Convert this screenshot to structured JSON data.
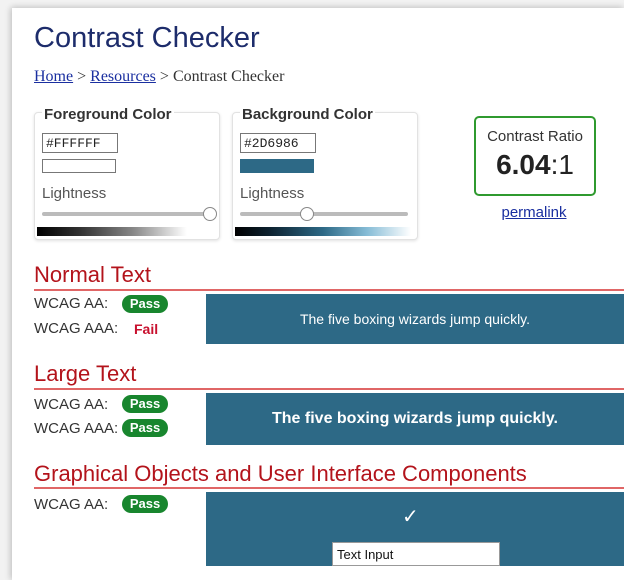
{
  "page": {
    "title": "Contrast Checker"
  },
  "breadcrumb": {
    "home": "Home",
    "sep1": " > ",
    "resources": "Resources",
    "sep2": " > ",
    "current": "Contrast Checker"
  },
  "foreground": {
    "title": "Foreground Color",
    "hex": "#FFFFFF",
    "swatch_color": "#ffffff",
    "lightness_label": "Lightness",
    "lightness_level": 1.0
  },
  "background": {
    "title": "Background Color",
    "hex": "#2D6986",
    "swatch_color": "#2d6986",
    "lightness_label": "Lightness",
    "lightness_level": 0.4
  },
  "ratio": {
    "label": "Contrast Ratio",
    "value": "6.04",
    "suffix": ":1",
    "border_color": "#2f9a2f"
  },
  "permalink": "permalink",
  "normal_text": {
    "title": "Normal Text",
    "aa_label": "WCAG AA:",
    "aa_result": "Pass",
    "aaa_label": "WCAG AAA:",
    "aaa_result": "Fail",
    "sample": "The five boxing wizards jump quickly."
  },
  "large_text": {
    "title": "Large Text",
    "aa_label": "WCAG AA:",
    "aa_result": "Pass",
    "aaa_label": "WCAG AAA:",
    "aaa_result": "Pass",
    "sample": "The five boxing wizards jump quickly."
  },
  "graphical": {
    "title": "Graphical Objects and User Interface Components",
    "aa_label": "WCAG AA:",
    "aa_result": "Pass",
    "check_glyph": "✓",
    "input_value": "Text Input"
  },
  "colors": {
    "pass": "#18862e",
    "fail": "#c8102e",
    "heading": "#b3131b",
    "title": "#1d2c6b",
    "link": "#1a2fa0",
    "preview_bg": "#2d6986"
  }
}
